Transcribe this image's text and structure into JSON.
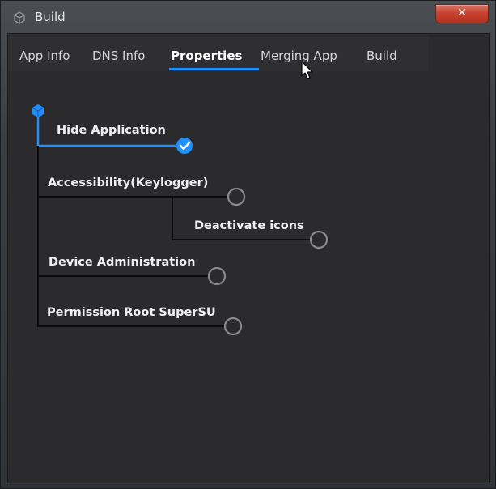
{
  "window": {
    "title": "Build",
    "close_glyph": "✕",
    "icon": "cube-icon"
  },
  "tabs": [
    {
      "label": "App Info",
      "active": false
    },
    {
      "label": "DNS Info",
      "active": false
    },
    {
      "label": "Properties",
      "active": true
    },
    {
      "label": "Merging App",
      "active": false
    },
    {
      "label": "Build",
      "active": false
    }
  ],
  "properties": {
    "root_icon": "cube-icon",
    "items": [
      {
        "label": "Hide Application",
        "checked": true
      },
      {
        "label": "Accessibility(Keylogger)",
        "checked": false
      },
      {
        "label": "Deactivate icons",
        "checked": false
      },
      {
        "label": "Device Administration",
        "checked": false
      },
      {
        "label": "Permission Root SuperSU",
        "checked": false
      }
    ]
  },
  "colors": {
    "accent": "#1e90ff",
    "unchecked_ring": "#8a8a8a",
    "background": "#2b2b2e"
  }
}
